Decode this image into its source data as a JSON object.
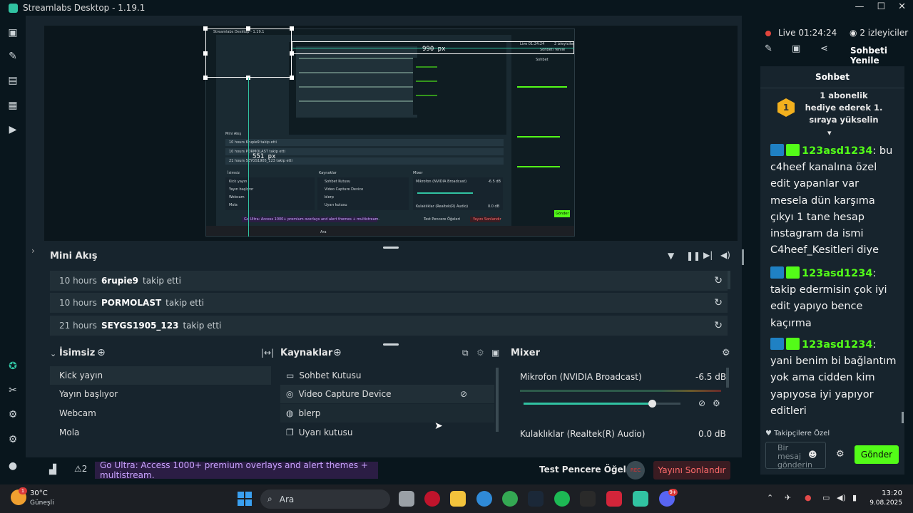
{
  "window": {
    "title": "Streamlabs Desktop - 1.19.1"
  },
  "preview": {
    "inner_title": "Streamlabs Desktop - 1.19.1",
    "guide_h_label": "990 px",
    "guide_v_label": "551 px",
    "inner_live": "Live 01:24:24",
    "inner_viewers": "2 izleyiciler",
    "inner_refresh": "Sohbeti Yenile",
    "inner_chat": "Sohbet",
    "inner_mini": "Mini Akış",
    "inner_feed": [
      "10 hours  6rupie9  takip etti",
      "10 hours  PORMOLAST  takip etti",
      "21 hours  SEYGS1905_123  takip etti"
    ],
    "inner_scene": "İsimsiz",
    "inner_sources": "Kaynaklar",
    "inner_mixer": "Mixer",
    "inner_mic": "Mikrofon (NVIDIA Broadcast)",
    "inner_mic_db": "-6.5 dB",
    "inner_headphones": "Kulaklıklar (Realtek(R) Audio)",
    "inner_hp_db": "0.0 dB",
    "inner_scenes": [
      "Kick yayın",
      "Yayın başlıyor",
      "Webcam",
      "Mola"
    ],
    "inner_sourcelist": [
      "Sohbet Kutusu",
      "Video Capture Device",
      "blerp",
      "Uyarı kutusu"
    ],
    "inner_ultra": "Go Ultra: Access 1000+ premium overlays and alert themes + multistream.",
    "inner_test": "Test Pencere Öğeleri",
    "inner_end": "Yayını Sonlandır",
    "inner_send": "Gönder",
    "inner_search": "Ara"
  },
  "stream": {
    "live_label": "Live",
    "time": "01:24:24",
    "viewers": "2 izleyiciler",
    "refresh_chat": "Sohbeti Yenile"
  },
  "chat": {
    "title": "Sohbet",
    "pinned": "1 abonelik hediye ederek 1. sıraya yükselin",
    "pinned_rank": "1",
    "messages": [
      {
        "user": "123asd1234",
        "text": " bu c4heef kanalına özel edit yapanlar var mesela dün karşıma çıkyı 1 tane hesap instagram da ismi C4heef_Kesitleri diye"
      },
      {
        "user": "123asd1234",
        "text": " takip edermisin çok iyi edit yapıyo bence kaçırma"
      },
      {
        "user": "123asd1234",
        "text": " yani benim bi bağlantım yok ama cidden kim yapıyosa iyi yapıyor editleri"
      }
    ],
    "colon": ":",
    "followers_only": "Takipçilere Özel",
    "input_placeholder": "Bir mesaj gönderin",
    "send": "Gönder"
  },
  "mini_feed": {
    "title": "Mini Akış",
    "rows": [
      {
        "time": "10 hours",
        "user": "6rupie9",
        "action": "takip etti"
      },
      {
        "time": "10 hours",
        "user": "PORMOLAST",
        "action": "takip etti"
      },
      {
        "time": "21 hours",
        "user": "SEYGS1905_123",
        "action": "takip etti"
      }
    ]
  },
  "scenes": {
    "title": "İsimsiz",
    "items": [
      "Kick yayın",
      "Yayın başlıyor",
      "Webcam",
      "Mola"
    ],
    "selected": 0
  },
  "sources": {
    "title": "Kaynaklar",
    "items": [
      "Sohbet Kutusu",
      "Video Capture Device",
      "blerp",
      "Uyarı kutusu"
    ]
  },
  "mixer": {
    "title": "Mixer",
    "items": [
      {
        "name": "Mikrofon (NVIDIA Broadcast)",
        "db": "-6.5 dB",
        "level": 0.82
      },
      {
        "name": "Kulaklıklar (Realtek(R) Audio)",
        "db": "0.0 dB",
        "level": 0.0
      }
    ]
  },
  "footer": {
    "alerts_count": "2",
    "ultra": "Go Ultra: Access 1000+ premium overlays and alert themes + multistream.",
    "test_widgets": "Test Pencere Öğeleri",
    "rec": "REC",
    "end_stream": "Yayını Sonlandır"
  },
  "taskbar": {
    "weather_temp": "30°C",
    "weather_desc": "Güneşli",
    "weather_badge": "1",
    "search": "Ara",
    "time": "13:20",
    "date": "9.08.2025",
    "discord_badge": "9+"
  },
  "colors": {
    "accent": "#31c3a2",
    "kick_green": "#53fc18",
    "live_red": "#e2453c",
    "bg": "#17242d",
    "panel": "#09161d"
  }
}
